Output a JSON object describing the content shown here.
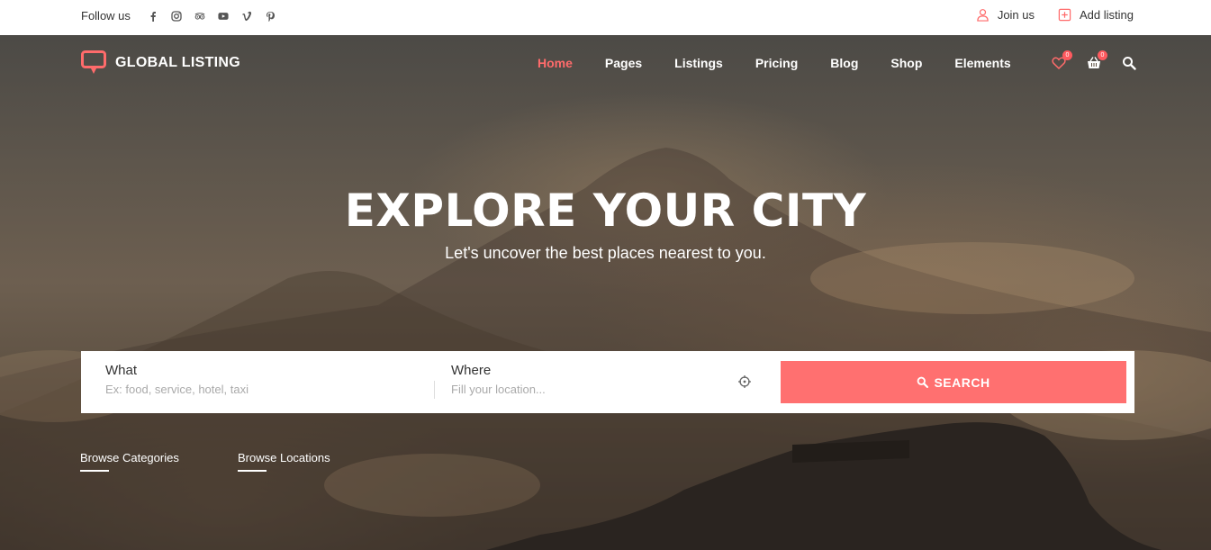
{
  "topbar": {
    "follow_label": "Follow us",
    "socials": [
      "facebook-icon",
      "instagram-icon",
      "tripadvisor-icon",
      "youtube-icon",
      "vimeo-icon",
      "pinterest-icon"
    ],
    "join_label": "Join us",
    "add_listing_label": "Add listing"
  },
  "header": {
    "logo_text": "GLOBAL LISTING",
    "nav": [
      "Home",
      "Pages",
      "Listings",
      "Pricing",
      "Blog",
      "Shop",
      "Elements"
    ],
    "active_nav": "Home",
    "wishlist_count": "0",
    "cart_count": "0"
  },
  "hero": {
    "title": "EXPLORE YOUR CITY",
    "subtitle": "Let's uncover the best places nearest to you."
  },
  "search": {
    "what_label": "What",
    "what_placeholder": "Ex: food, service, hotel, taxi",
    "where_label": "Where",
    "where_placeholder": "Fill your location...",
    "button_label": "SEARCH"
  },
  "browse": {
    "categories_label": "Browse Categories",
    "locations_label": "Browse Locations"
  },
  "colors": {
    "accent": "#ff7070",
    "active_nav": "#ff6b6b",
    "badge": "#ff5a5f"
  }
}
